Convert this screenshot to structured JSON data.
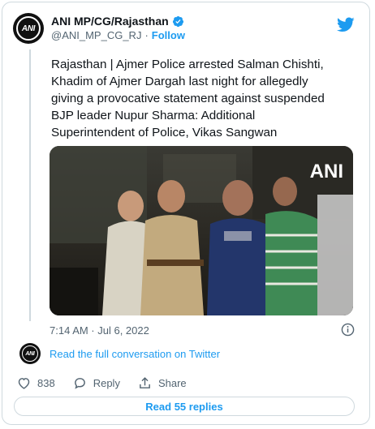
{
  "tweet": {
    "author_name": "ANI MP/CG/Rajasthan",
    "handle": "@ANI_MP_CG_RJ",
    "separator": "·",
    "follow_label": "Follow",
    "avatar_text": "ANI",
    "text": "Rajasthan | Ajmer Police arrested Salman Chishti,\nKhadim of Ajmer Dargah last night for allegedly\ngiving a provocative statement against suspended\nBJP leader Nupur Sharma: Additional\nSuperintendent of Police, Vikas Sangwan",
    "media_watermark": "ANI",
    "timestamp": "7:14 AM · Jul 6, 2022",
    "conversation_link": "Read the full conversation on Twitter",
    "likes_count": "838",
    "reply_label": "Reply",
    "share_label": "Share",
    "read_replies_label": "Read 55 replies"
  },
  "colors": {
    "brand_blue": "#1d9bf0",
    "text_primary": "#0f1419",
    "text_secondary": "#536471",
    "border": "#cfd9de",
    "like_red": "#f91880"
  },
  "icons": {
    "verified": "verified-badge-icon",
    "twitter": "twitter-bird-icon",
    "info": "info-icon",
    "like": "heart-icon",
    "reply": "reply-bubble-icon",
    "share": "share-icon"
  }
}
